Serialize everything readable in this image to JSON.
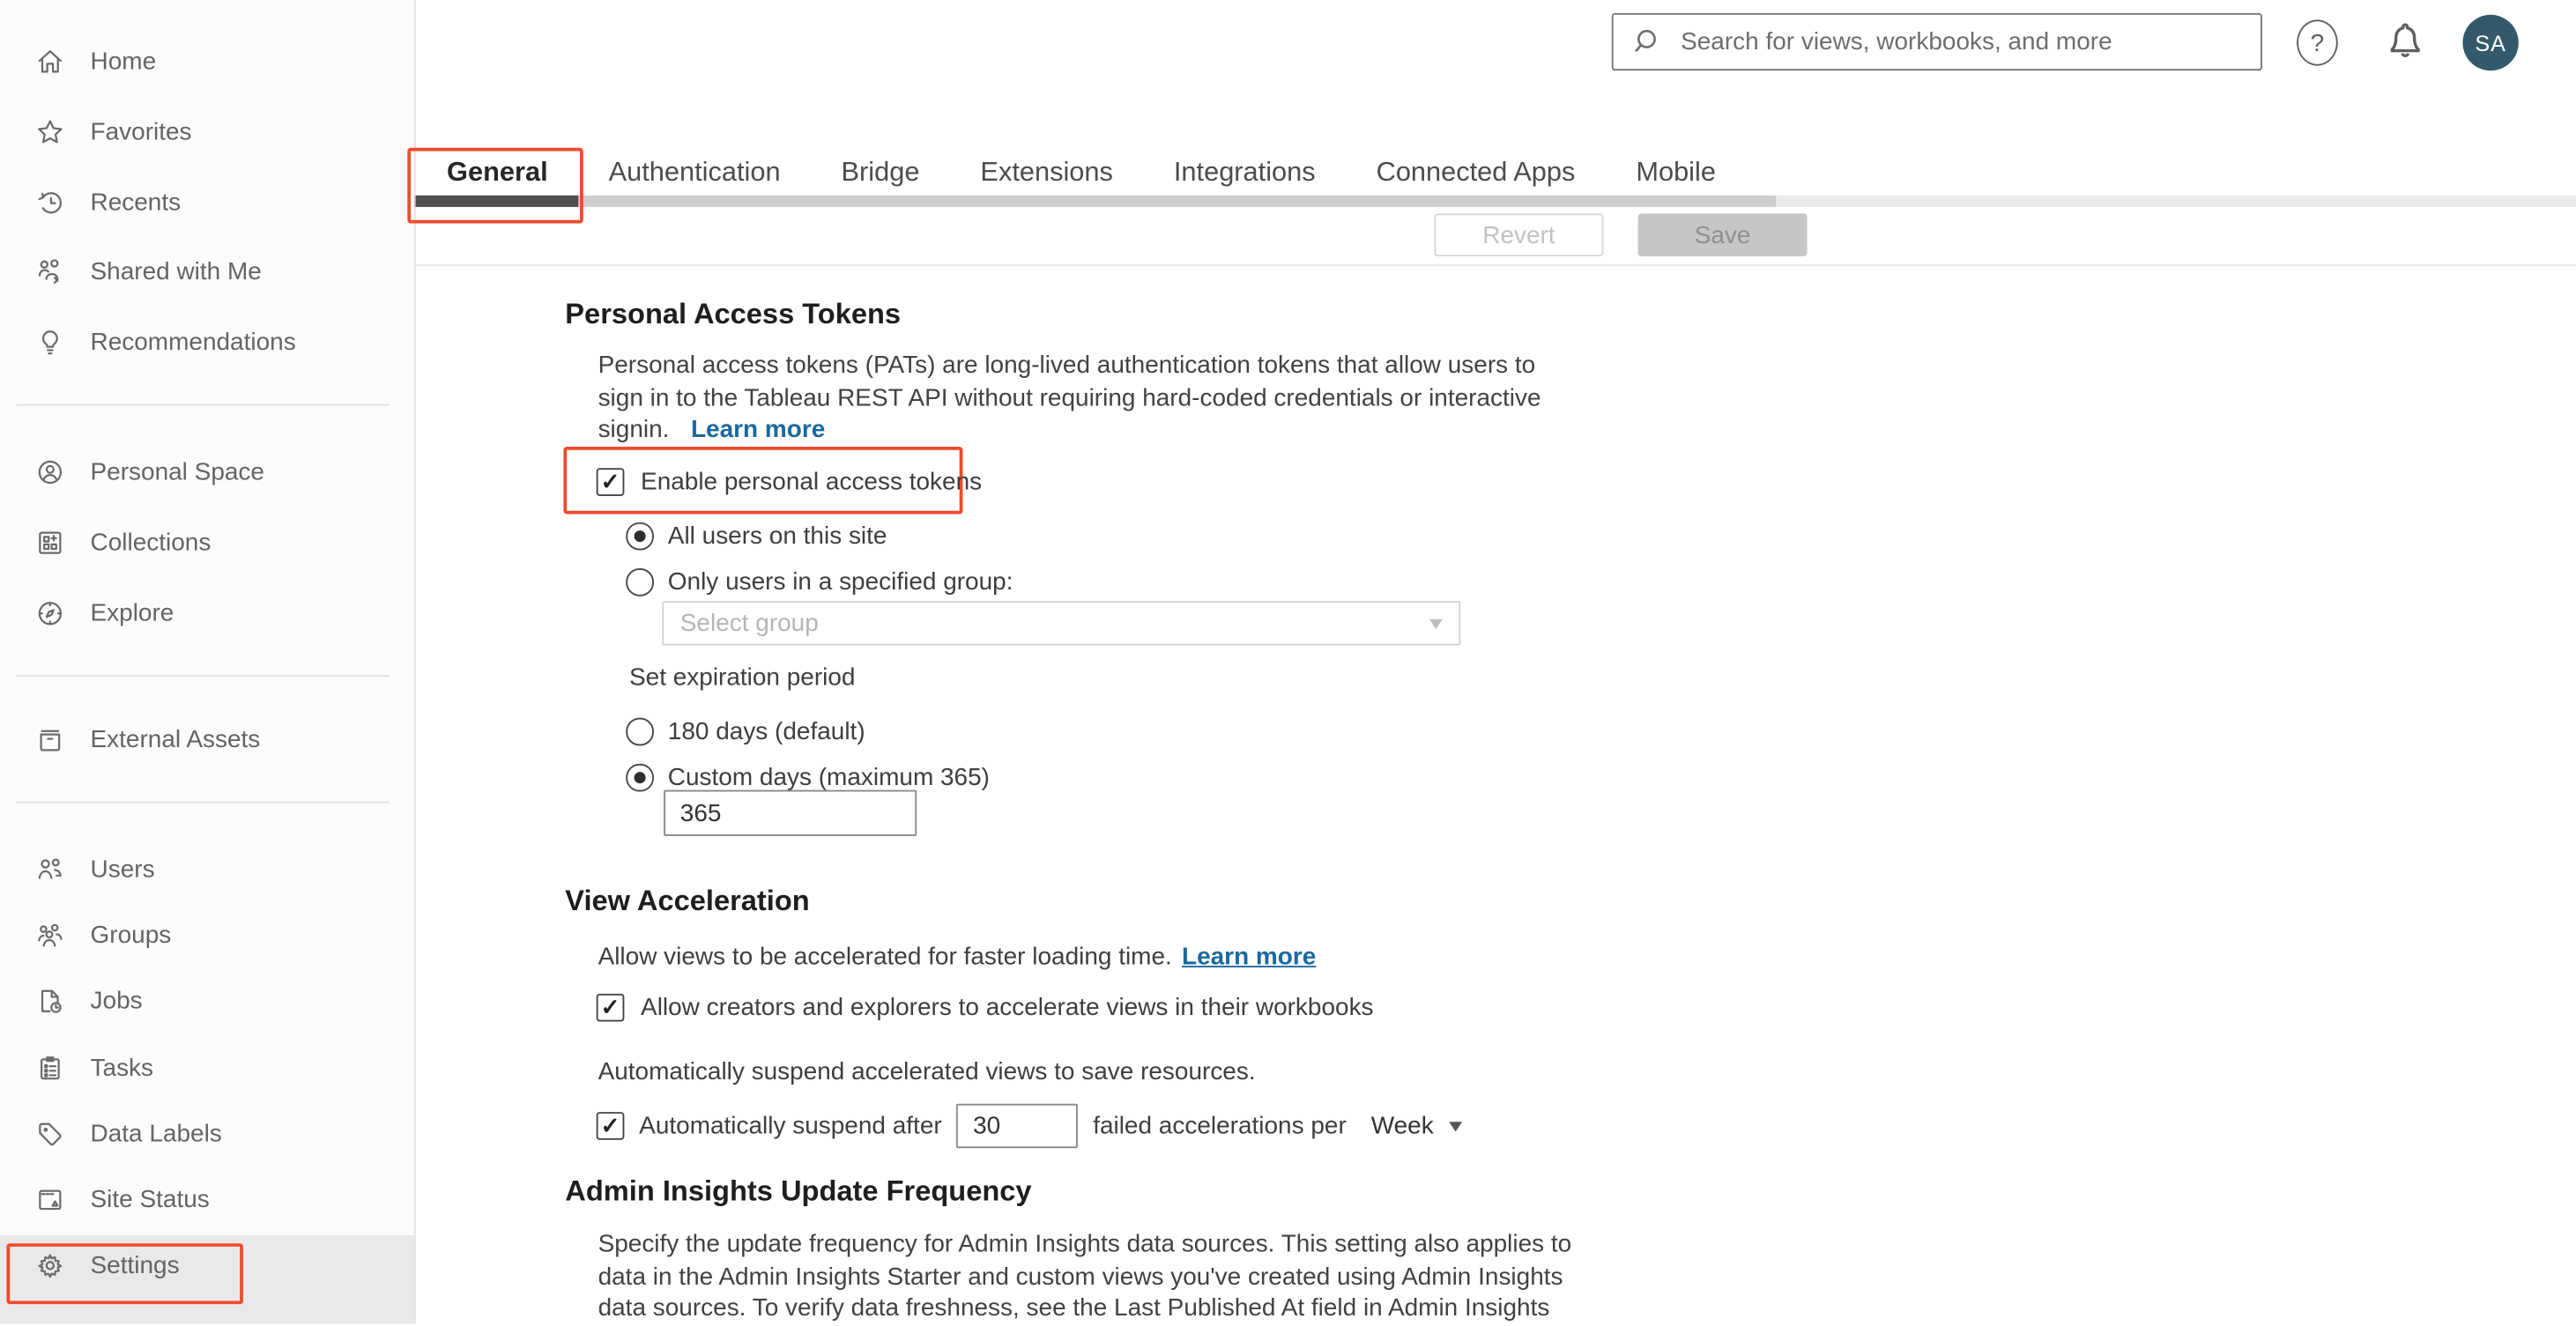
{
  "topbar": {
    "search_placeholder": "Search for views, workbooks, and more",
    "avatar_initials": "SA"
  },
  "sidebar": {
    "items": [
      {
        "label": "Home",
        "icon": "home-icon"
      },
      {
        "label": "Favorites",
        "icon": "star-icon"
      },
      {
        "label": "Recents",
        "icon": "history-icon"
      },
      {
        "label": "Shared with Me",
        "icon": "shared-icon"
      },
      {
        "label": "Recommendations",
        "icon": "lightbulb-icon"
      },
      {
        "label": "Personal Space",
        "icon": "person-circle-icon"
      },
      {
        "label": "Collections",
        "icon": "collections-icon"
      },
      {
        "label": "Explore",
        "icon": "compass-icon"
      },
      {
        "label": "External Assets",
        "icon": "archive-icon"
      },
      {
        "label": "Users",
        "icon": "users-icon"
      },
      {
        "label": "Groups",
        "icon": "groups-icon"
      },
      {
        "label": "Jobs",
        "icon": "jobs-icon"
      },
      {
        "label": "Tasks",
        "icon": "tasks-icon"
      },
      {
        "label": "Data Labels",
        "icon": "tag-icon"
      },
      {
        "label": "Site Status",
        "icon": "site-status-icon"
      },
      {
        "label": "Settings",
        "icon": "gear-icon"
      }
    ],
    "active_item": "Settings"
  },
  "tabs": {
    "items": [
      {
        "label": "General"
      },
      {
        "label": "Authentication"
      },
      {
        "label": "Bridge"
      },
      {
        "label": "Extensions"
      },
      {
        "label": "Integrations"
      },
      {
        "label": "Connected Apps"
      },
      {
        "label": "Mobile"
      }
    ],
    "active": "General"
  },
  "actions": {
    "revert_label": "Revert",
    "save_label": "Save"
  },
  "sections": {
    "pat": {
      "title": "Personal Access Tokens",
      "description_lines": [
        "Personal access tokens (PATs) are long-lived authentication tokens that allow users to",
        "sign in to the Tableau REST API without requiring hard-coded credentials or interactive",
        "signin."
      ],
      "learn_more_label": "Learn more",
      "enable_checkbox_label": "Enable personal access tokens",
      "enable_checked": true,
      "scope_options": [
        {
          "label": "All users on this site",
          "selected": true
        },
        {
          "label": "Only users in a specified group:",
          "selected": false
        }
      ],
      "group_select_placeholder": "Select group",
      "expiration_label": "Set expiration period",
      "expiration_options": [
        {
          "label": "180 days (default)",
          "selected": false
        },
        {
          "label": "Custom days (maximum 365)",
          "selected": true
        }
      ],
      "custom_days_value": "365"
    },
    "view_acceleration": {
      "title": "View Acceleration",
      "description": "Allow views to be accelerated for faster loading time.",
      "learn_more_label": "Learn more",
      "allow_checkbox_label": "Allow creators and explorers to accelerate views in their workbooks",
      "allow_checked": true,
      "suspend_description": "Automatically suspend accelerated views to save resources.",
      "suspend_checkbox_label": "Automatically suspend after",
      "suspend_checked": true,
      "suspend_threshold_value": "30",
      "suspend_suffix": "failed accelerations per",
      "suspend_period_value": "Week"
    },
    "admin_insights": {
      "title": "Admin Insights Update Frequency",
      "description_lines": [
        "Specify the update frequency for Admin Insights data sources. This setting also applies to",
        "data in the Admin Insights Starter and custom views you've created using Admin Insights",
        "data sources. To verify data freshness, see the Last Published At field in Admin Insights"
      ]
    }
  },
  "colors": {
    "annotation_red": "#F1492C",
    "link_blue": "#1A699E",
    "avatar_bg": "#33596B"
  }
}
